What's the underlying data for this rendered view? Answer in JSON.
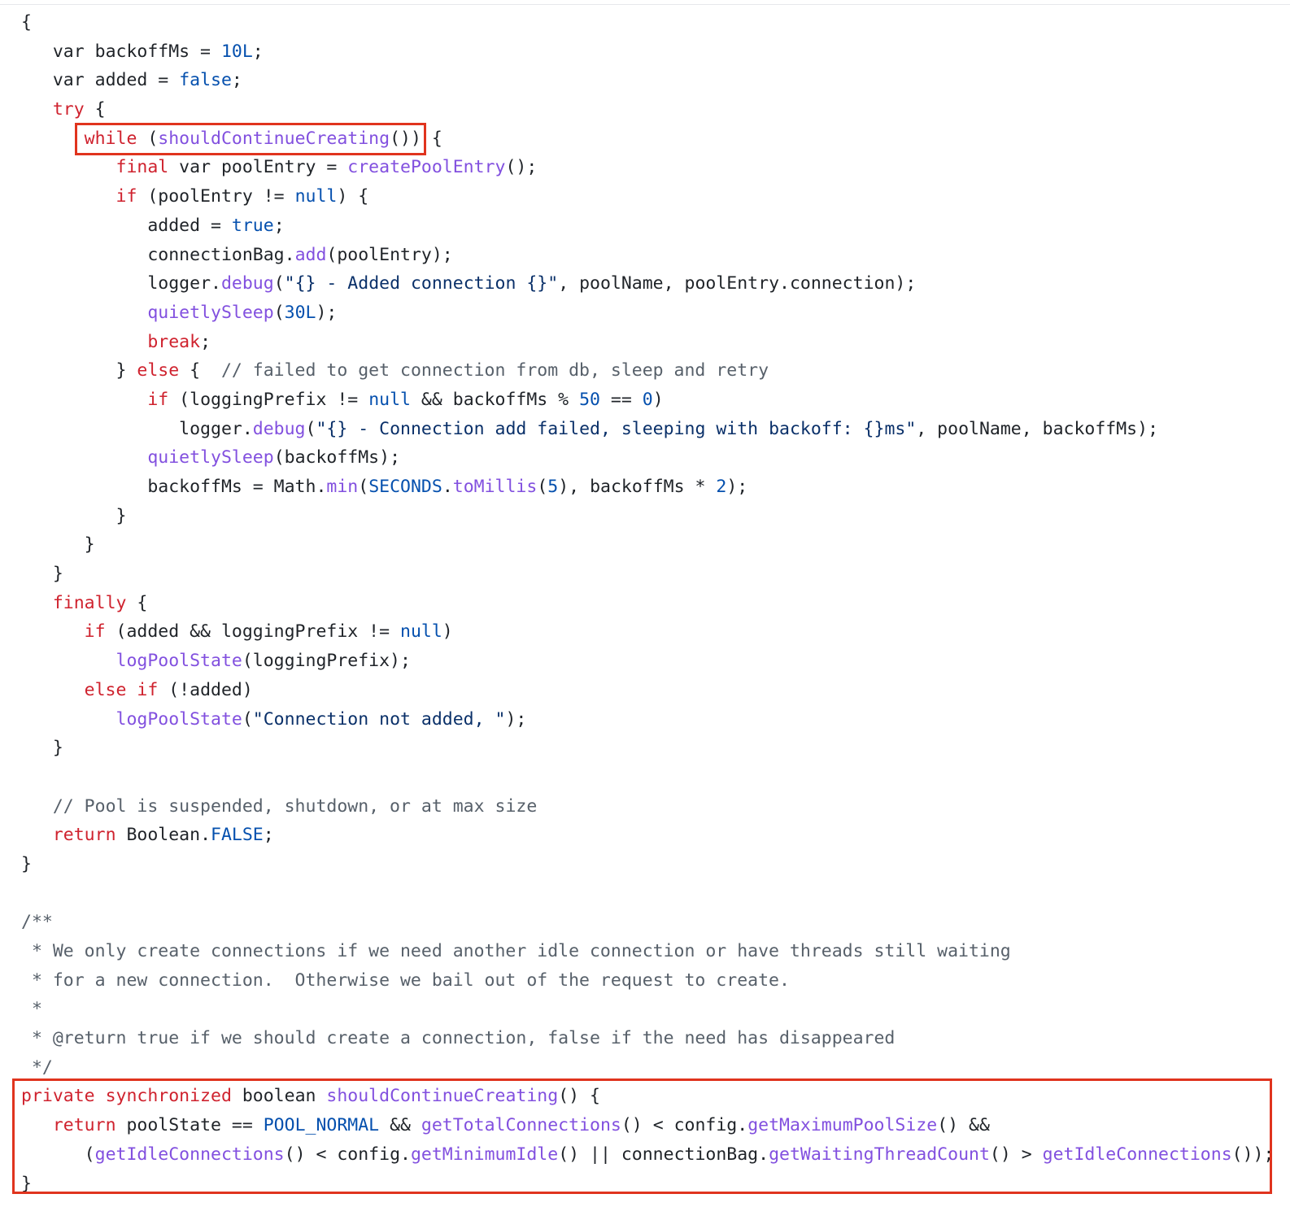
{
  "code": {
    "language": "java",
    "lines": [
      {
        "indent": 0,
        "tokens": [
          {
            "t": "{",
            "c": "pl"
          }
        ]
      },
      {
        "indent": 1,
        "tokens": [
          {
            "t": "var backoffMs = ",
            "c": "pl"
          },
          {
            "t": "10L",
            "c": "lit"
          },
          {
            "t": ";",
            "c": "pl"
          }
        ]
      },
      {
        "indent": 1,
        "tokens": [
          {
            "t": "var added = ",
            "c": "pl"
          },
          {
            "t": "false",
            "c": "lit"
          },
          {
            "t": ";",
            "c": "pl"
          }
        ]
      },
      {
        "indent": 1,
        "tokens": [
          {
            "t": "try",
            "c": "kw"
          },
          {
            "t": " {",
            "c": "pl"
          }
        ]
      },
      {
        "indent": 2,
        "tokens": [
          {
            "t": "while",
            "c": "kw"
          },
          {
            "t": " (",
            "c": "pl"
          },
          {
            "t": "shouldContinueCreating",
            "c": "fn"
          },
          {
            "t": "()) {",
            "c": "pl"
          }
        ]
      },
      {
        "indent": 3,
        "tokens": [
          {
            "t": "final",
            "c": "kw"
          },
          {
            "t": " var poolEntry = ",
            "c": "pl"
          },
          {
            "t": "createPoolEntry",
            "c": "fn"
          },
          {
            "t": "();",
            "c": "pl"
          }
        ]
      },
      {
        "indent": 3,
        "tokens": [
          {
            "t": "if",
            "c": "kw"
          },
          {
            "t": " (poolEntry != ",
            "c": "pl"
          },
          {
            "t": "null",
            "c": "lit"
          },
          {
            "t": ") {",
            "c": "pl"
          }
        ]
      },
      {
        "indent": 4,
        "tokens": [
          {
            "t": "added = ",
            "c": "pl"
          },
          {
            "t": "true",
            "c": "lit"
          },
          {
            "t": ";",
            "c": "pl"
          }
        ]
      },
      {
        "indent": 4,
        "tokens": [
          {
            "t": "connectionBag.",
            "c": "pl"
          },
          {
            "t": "add",
            "c": "fn"
          },
          {
            "t": "(poolEntry);",
            "c": "pl"
          }
        ]
      },
      {
        "indent": 4,
        "tokens": [
          {
            "t": "logger.",
            "c": "pl"
          },
          {
            "t": "debug",
            "c": "fn"
          },
          {
            "t": "(",
            "c": "pl"
          },
          {
            "t": "\"{} - Added connection {}\"",
            "c": "str"
          },
          {
            "t": ", poolName, poolEntry.connection);",
            "c": "pl"
          }
        ]
      },
      {
        "indent": 4,
        "tokens": [
          {
            "t": "quietlySleep",
            "c": "fn"
          },
          {
            "t": "(",
            "c": "pl"
          },
          {
            "t": "30L",
            "c": "lit"
          },
          {
            "t": ");",
            "c": "pl"
          }
        ]
      },
      {
        "indent": 4,
        "tokens": [
          {
            "t": "break",
            "c": "kw"
          },
          {
            "t": ";",
            "c": "pl"
          }
        ]
      },
      {
        "indent": 3,
        "tokens": [
          {
            "t": "} ",
            "c": "pl"
          },
          {
            "t": "else",
            "c": "kw"
          },
          {
            "t": " {  ",
            "c": "pl"
          },
          {
            "t": "// failed to get connection from db, sleep and retry",
            "c": "cm"
          }
        ]
      },
      {
        "indent": 4,
        "tokens": [
          {
            "t": "if",
            "c": "kw"
          },
          {
            "t": " (loggingPrefix != ",
            "c": "pl"
          },
          {
            "t": "null",
            "c": "lit"
          },
          {
            "t": " && backoffMs % ",
            "c": "pl"
          },
          {
            "t": "50",
            "c": "lit"
          },
          {
            "t": " == ",
            "c": "pl"
          },
          {
            "t": "0",
            "c": "lit"
          },
          {
            "t": ")",
            "c": "pl"
          }
        ]
      },
      {
        "indent": 5,
        "tokens": [
          {
            "t": "logger.",
            "c": "pl"
          },
          {
            "t": "debug",
            "c": "fn"
          },
          {
            "t": "(",
            "c": "pl"
          },
          {
            "t": "\"{} - Connection add failed, sleeping with backoff: {}ms\"",
            "c": "str"
          },
          {
            "t": ", poolName, backoffMs);",
            "c": "pl"
          }
        ]
      },
      {
        "indent": 4,
        "tokens": [
          {
            "t": "quietlySleep",
            "c": "fn"
          },
          {
            "t": "(backoffMs);",
            "c": "pl"
          }
        ]
      },
      {
        "indent": 4,
        "tokens": [
          {
            "t": "backoffMs = Math.",
            "c": "pl"
          },
          {
            "t": "min",
            "c": "fn"
          },
          {
            "t": "(",
            "c": "pl"
          },
          {
            "t": "SECONDS",
            "c": "lit"
          },
          {
            "t": ".",
            "c": "pl"
          },
          {
            "t": "toMillis",
            "c": "fn"
          },
          {
            "t": "(",
            "c": "pl"
          },
          {
            "t": "5",
            "c": "lit"
          },
          {
            "t": "), backoffMs * ",
            "c": "pl"
          },
          {
            "t": "2",
            "c": "lit"
          },
          {
            "t": ");",
            "c": "pl"
          }
        ]
      },
      {
        "indent": 3,
        "tokens": [
          {
            "t": "}",
            "c": "pl"
          }
        ]
      },
      {
        "indent": 2,
        "tokens": [
          {
            "t": "}",
            "c": "pl"
          }
        ]
      },
      {
        "indent": 1,
        "tokens": [
          {
            "t": "}",
            "c": "pl"
          }
        ]
      },
      {
        "indent": 1,
        "tokens": [
          {
            "t": "finally",
            "c": "kw"
          },
          {
            "t": " {",
            "c": "pl"
          }
        ]
      },
      {
        "indent": 2,
        "tokens": [
          {
            "t": "if",
            "c": "kw"
          },
          {
            "t": " (added && loggingPrefix != ",
            "c": "pl"
          },
          {
            "t": "null",
            "c": "lit"
          },
          {
            "t": ")",
            "c": "pl"
          }
        ]
      },
      {
        "indent": 3,
        "tokens": [
          {
            "t": "logPoolState",
            "c": "fn"
          },
          {
            "t": "(loggingPrefix);",
            "c": "pl"
          }
        ]
      },
      {
        "indent": 2,
        "tokens": [
          {
            "t": "else",
            "c": "kw"
          },
          {
            "t": " ",
            "c": "pl"
          },
          {
            "t": "if",
            "c": "kw"
          },
          {
            "t": " (!added)",
            "c": "pl"
          }
        ]
      },
      {
        "indent": 3,
        "tokens": [
          {
            "t": "logPoolState",
            "c": "fn"
          },
          {
            "t": "(",
            "c": "pl"
          },
          {
            "t": "\"Connection not added, \"",
            "c": "str"
          },
          {
            "t": ");",
            "c": "pl"
          }
        ]
      },
      {
        "indent": 1,
        "tokens": [
          {
            "t": "}",
            "c": "pl"
          }
        ]
      },
      {
        "indent": 0,
        "tokens": []
      },
      {
        "indent": 1,
        "tokens": [
          {
            "t": "// Pool is suspended, shutdown, or at max size",
            "c": "cm"
          }
        ]
      },
      {
        "indent": 1,
        "tokens": [
          {
            "t": "return",
            "c": "kw"
          },
          {
            "t": " Boolean.",
            "c": "pl"
          },
          {
            "t": "FALSE",
            "c": "lit"
          },
          {
            "t": ";",
            "c": "pl"
          }
        ]
      },
      {
        "indent": 0,
        "tokens": [
          {
            "t": "}",
            "c": "pl"
          }
        ]
      },
      {
        "indent": 0,
        "tokens": []
      },
      {
        "indent": 0,
        "tokens": [
          {
            "t": "/**",
            "c": "cm"
          }
        ]
      },
      {
        "indent": 0,
        "tokens": [
          {
            "t": " * We only create connections if we need another idle connection or have threads still waiting",
            "c": "cm"
          }
        ]
      },
      {
        "indent": 0,
        "tokens": [
          {
            "t": " * for a new connection.  Otherwise we bail out of the request to create.",
            "c": "cm"
          }
        ]
      },
      {
        "indent": 0,
        "tokens": [
          {
            "t": " *",
            "c": "cm"
          }
        ]
      },
      {
        "indent": 0,
        "tokens": [
          {
            "t": " * @return true if we should create a connection, false if the need has disappeared",
            "c": "cm"
          }
        ]
      },
      {
        "indent": 0,
        "tokens": [
          {
            "t": " */",
            "c": "cm"
          }
        ]
      },
      {
        "indent": 0,
        "tokens": [
          {
            "t": "private",
            "c": "kw"
          },
          {
            "t": " ",
            "c": "pl"
          },
          {
            "t": "synchronized",
            "c": "kw"
          },
          {
            "t": " boolean ",
            "c": "pl"
          },
          {
            "t": "shouldContinueCreating",
            "c": "fn"
          },
          {
            "t": "() {",
            "c": "pl"
          }
        ]
      },
      {
        "indent": 1,
        "tokens": [
          {
            "t": "return",
            "c": "kw"
          },
          {
            "t": " poolState == ",
            "c": "pl"
          },
          {
            "t": "POOL_NORMAL",
            "c": "lit"
          },
          {
            "t": " && ",
            "c": "pl"
          },
          {
            "t": "getTotalConnections",
            "c": "fn"
          },
          {
            "t": "() < config.",
            "c": "pl"
          },
          {
            "t": "getMaximumPoolSize",
            "c": "fn"
          },
          {
            "t": "() &&",
            "c": "pl"
          }
        ]
      },
      {
        "indent": 2,
        "tokens": [
          {
            "t": "(",
            "c": "pl"
          },
          {
            "t": "getIdleConnections",
            "c": "fn"
          },
          {
            "t": "() < config.",
            "c": "pl"
          },
          {
            "t": "getMinimumIdle",
            "c": "fn"
          },
          {
            "t": "() || connectionBag.",
            "c": "pl"
          },
          {
            "t": "getWaitingThreadCount",
            "c": "fn"
          },
          {
            "t": "() > ",
            "c": "pl"
          },
          {
            "t": "getIdleConnections",
            "c": "fn"
          },
          {
            "t": "());",
            "c": "pl"
          }
        ]
      },
      {
        "indent": 0,
        "tokens": [
          {
            "t": "}",
            "c": "pl"
          }
        ]
      }
    ]
  },
  "colors": {
    "keyword": "#cf222e",
    "function": "#8250df",
    "literal": "#0550ae",
    "string": "#0a3069",
    "comment": "#57606a",
    "plain": "#1f2328",
    "highlight_box": "#e0341e"
  }
}
